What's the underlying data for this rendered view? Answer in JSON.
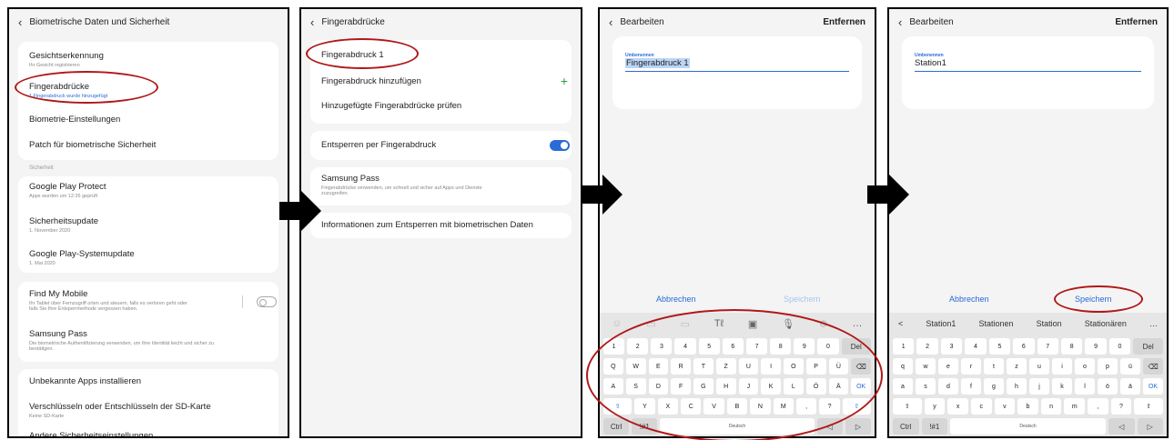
{
  "panel1": {
    "title": "Biometrische Daten und Sicherheit",
    "face": {
      "title": "Gesichtserkennung",
      "sub": "Ihr Gesicht registrieren"
    },
    "finger": {
      "title": "Fingerabdrücke",
      "sub": "1 Fingerabdruck wurde hinzugefügt"
    },
    "settings": "Biometrie-Einstellungen",
    "patch": "Patch für biometrische Sicherheit",
    "section": "Sicherheit",
    "play": {
      "title": "Google Play Protect",
      "sub": "Apps wurden um 12:26 geprüft"
    },
    "update": {
      "title": "Sicherheitsupdate",
      "sub": "1. November 2020"
    },
    "sysupdate": {
      "title": "Google Play-Systemupdate",
      "sub": "1. Mai 2020"
    },
    "findmy": {
      "title": "Find My Mobile",
      "sub": "Ihr Tablet über Fernzugriff orten und steuern, falls es verloren geht oder",
      "sub2": "falls Sie Ihre Entsperrmethode vergessen haben."
    },
    "spass": {
      "title": "Samsung Pass",
      "sub": "Die biometrische Authentifizierung verwenden, um Ihre Identität leicht und sicher zu",
      "sub2": "bestätigen."
    },
    "unknown": "Unbekannte Apps installieren",
    "encrypt": {
      "title": "Verschlüsseln oder Entschlüsseln der SD-Karte",
      "sub": "Keine SD-Karte"
    },
    "other": "Andere Sicherheitseinstellungen"
  },
  "panel2": {
    "title": "Fingerabdrücke",
    "fp1": "Fingerabdruck 1",
    "add": "Fingerabdruck hinzufügen",
    "add_icon": "plus-icon",
    "check": "Hinzugefügte Fingerabdrücke prüfen",
    "unlock": "Entsperren per Fingerabdruck",
    "spass": {
      "title": "Samsung Pass",
      "sub": "Fingerabdrücke verwenden, um schnell und sicher auf Apps und Dienste",
      "sub2": "zuzugreifen."
    },
    "info": "Informationen zum Entsperren mit biometrischen Daten"
  },
  "panel3": {
    "title": "Bearbeiten",
    "action": "Entfernen",
    "label": "Umbenennen",
    "value": "Fingerabdruck 1",
    "cancel": "Abbrechen",
    "save": "Speichern",
    "tools": [
      "☺",
      "▭",
      "▭",
      "Tℓ",
      "▣",
      "🎙",
      "⚙",
      "…"
    ]
  },
  "panel4": {
    "title": "Bearbeiten",
    "action": "Entfernen",
    "label": "Umbenennen",
    "value": "Station1",
    "cancel": "Abbrechen",
    "save": "Speichern",
    "suggestions": [
      "<",
      "Station1",
      "Stationen",
      "Station",
      "Stationären",
      "…"
    ]
  },
  "keyboard_upper": {
    "row1": [
      "1",
      "2",
      "3",
      "4",
      "5",
      "6",
      "7",
      "8",
      "9",
      "0",
      "Del"
    ],
    "row2": [
      "Q",
      "W",
      "E",
      "R",
      "T",
      "Z",
      "U",
      "I",
      "O",
      "P",
      "Ü",
      "⌫"
    ],
    "row3": [
      "A",
      "S",
      "D",
      "F",
      "G",
      "H",
      "J",
      "K",
      "L",
      "Ö",
      "Ä",
      "OK"
    ],
    "row4": [
      "⇧",
      "Y",
      "X",
      "C",
      "V",
      "B",
      "N",
      "M",
      ",",
      "?",
      "⇧"
    ],
    "row5": [
      "Ctrl",
      "!#1",
      "Deutsch",
      "◁",
      "▷"
    ]
  },
  "keyboard_lower": {
    "row1": [
      "1",
      "2",
      "3",
      "4",
      "5",
      "6",
      "7",
      "8",
      "9",
      "0",
      "Del"
    ],
    "row2": [
      "q",
      "w",
      "e",
      "r",
      "t",
      "z",
      "u",
      "i",
      "o",
      "p",
      "ü",
      "⌫"
    ],
    "row3": [
      "a",
      "s",
      "d",
      "f",
      "g",
      "h",
      "j",
      "k",
      "l",
      "ö",
      "ä",
      "OK"
    ],
    "row4": [
      "⇧",
      "y",
      "x",
      "c",
      "v",
      "b",
      "n",
      "m",
      ",",
      "?",
      "⇧"
    ],
    "row5": [
      "Ctrl",
      "!#1",
      "Deutsch",
      "◁",
      "▷"
    ]
  },
  "colors": {
    "accent": "#2a6bd6",
    "highlight": "#b01818",
    "arrow": "#000000"
  }
}
